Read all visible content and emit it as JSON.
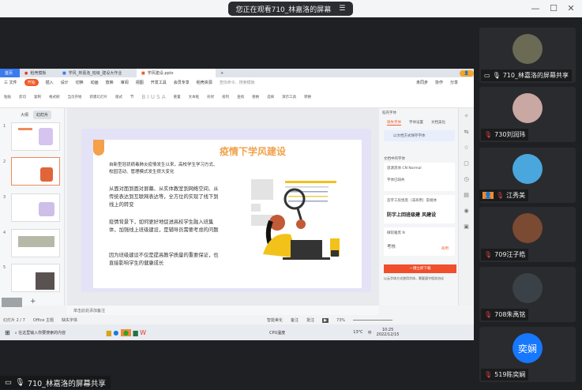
{
  "meeting": {
    "notice": "您正在观看710_林嘉洛的屏幕",
    "window_controls": [
      "—",
      "☐",
      "✕"
    ],
    "presenter_label": "710_林嘉洛的屏幕共享"
  },
  "participants": [
    {
      "name": "710_林嘉洛的屏幕共享",
      "avatar_color": "#6b6b55",
      "sharing": true,
      "mic": "on"
    },
    {
      "name": "730刘润玮",
      "avatar_color": "#c9a7a2",
      "mic": "muted"
    },
    {
      "name": "江秀美",
      "avatar_color": "#4aa7de",
      "mic": "muted",
      "host_badge": true
    },
    {
      "name": "709汪子皓",
      "avatar_color": "#7a4a32",
      "mic": "muted"
    },
    {
      "name": "708朱禹铭",
      "avatar_color": "#3a4248",
      "mic": "muted"
    },
    {
      "name": "519陈奕娴",
      "avatar_text": "奕娴",
      "avatar_color": "#1677ff",
      "mic": "muted"
    }
  ],
  "app": {
    "tabs": [
      "首页",
      "稻壳模板",
      "学风_林嘉洛_班级_建设大作业",
      "学风建设.pptx"
    ],
    "menu": [
      "三 文件",
      "开始",
      "插入",
      "设计",
      "切换",
      "动画",
      "放映",
      "审阅",
      "视图",
      "开发工具",
      "会员专享",
      "稻壳资源",
      "查找命令、搜索模板"
    ],
    "menu_active": "开始",
    "menu_right": [
      "未同步",
      "协作",
      "分享"
    ],
    "toolbar": [
      "粘贴",
      "剪切",
      "复制",
      "格式刷",
      "当页开始",
      "新建幻灯片",
      "版式",
      "节",
      "重置",
      "文本框",
      "形状",
      "排列",
      "查找",
      "替换",
      "选择",
      "演示工具",
      "转换"
    ],
    "left_panel_tabs": [
      "大纲",
      "幻灯片"
    ],
    "slide_count": 5,
    "selected_slide": 2,
    "slide": {
      "title": "疫情下学风建设",
      "paragraphs": [
        "自新型冠状病毒肺炎疫情发生以来，高校学生学习方式、校园活动、管理模式发生很大变化",
        "从面对面到面对屏幕、从实体教室到网络空间、从传统表达到互联网表达等，全方位的实现了线下到线上的转变",
        "疫情背景下，如何更好地促进高校学生融入班集体，加强线上班级建设，是辅导员需要考虑的问题",
        "因为班级建设不仅是提高教学质量的重要保证，也直接影响学生的健康成长"
      ]
    },
    "right_panel": {
      "title": "稻壳字体",
      "tabs": [
        "缺失字体",
        "字体设置",
        "文档美化"
      ],
      "notice": "以文档方式保存字体",
      "section": "文档中的字体",
      "fonts": [
        {
          "name": "思源黑体 CN Normal",
          "note": "字体已缺失"
        },
        {
          "name": "造字工房悦黑（非商用）常规体",
          "sample": "防字上回班级建 风建设"
        },
        {
          "name": "微软雅黑 N",
          "sample": "考核",
          "tag": "商用"
        }
      ],
      "download": "一键立即下载",
      "footer": "以云字体方式使用字体，需要遵守相关协议"
    },
    "notes_placeholder": "单击此处添加备注",
    "status": {
      "slide": "幻灯片 2 / 7",
      "theme": "Office 主题",
      "missing_font": "缺失字体",
      "beautify": "智能美化",
      "notes": "备注",
      "comments": "批注",
      "zoom": "73%",
      "zoom_level": 0.73
    },
    "taskbar": {
      "search": "在这里输入你要搜索的内容",
      "cpu": "CPU温度",
      "weather": "13°C",
      "ime": "中",
      "time": "10:25",
      "date": "2022/12/15"
    }
  }
}
